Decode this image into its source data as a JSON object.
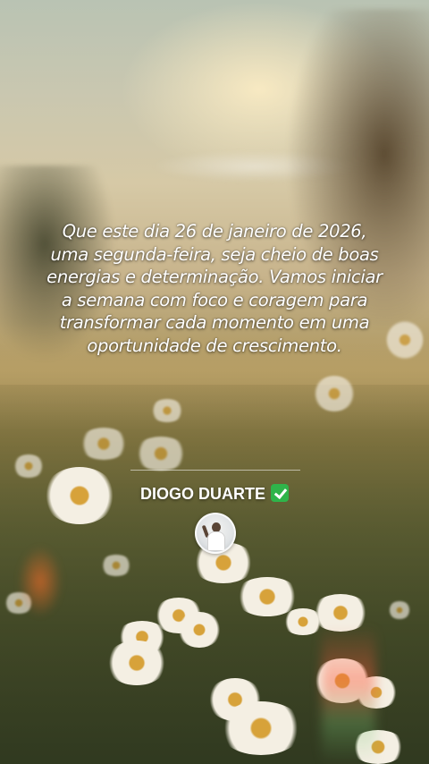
{
  "post": {
    "quote": "Que este dia 26 de janeiro de 2026, uma segunda-feira, seja cheio de boas energias e determinação. Vamos iniciar a semana com foco e coragem para transformar cada momento em uma oportunidade de crescimento.",
    "author": "DIOGO DUARTE",
    "verified_icon": "check-mark-button-icon",
    "avatar_icon": "profile-photo"
  },
  "colors": {
    "text": "#ffffff",
    "verified_badge": "#2fb44a"
  }
}
